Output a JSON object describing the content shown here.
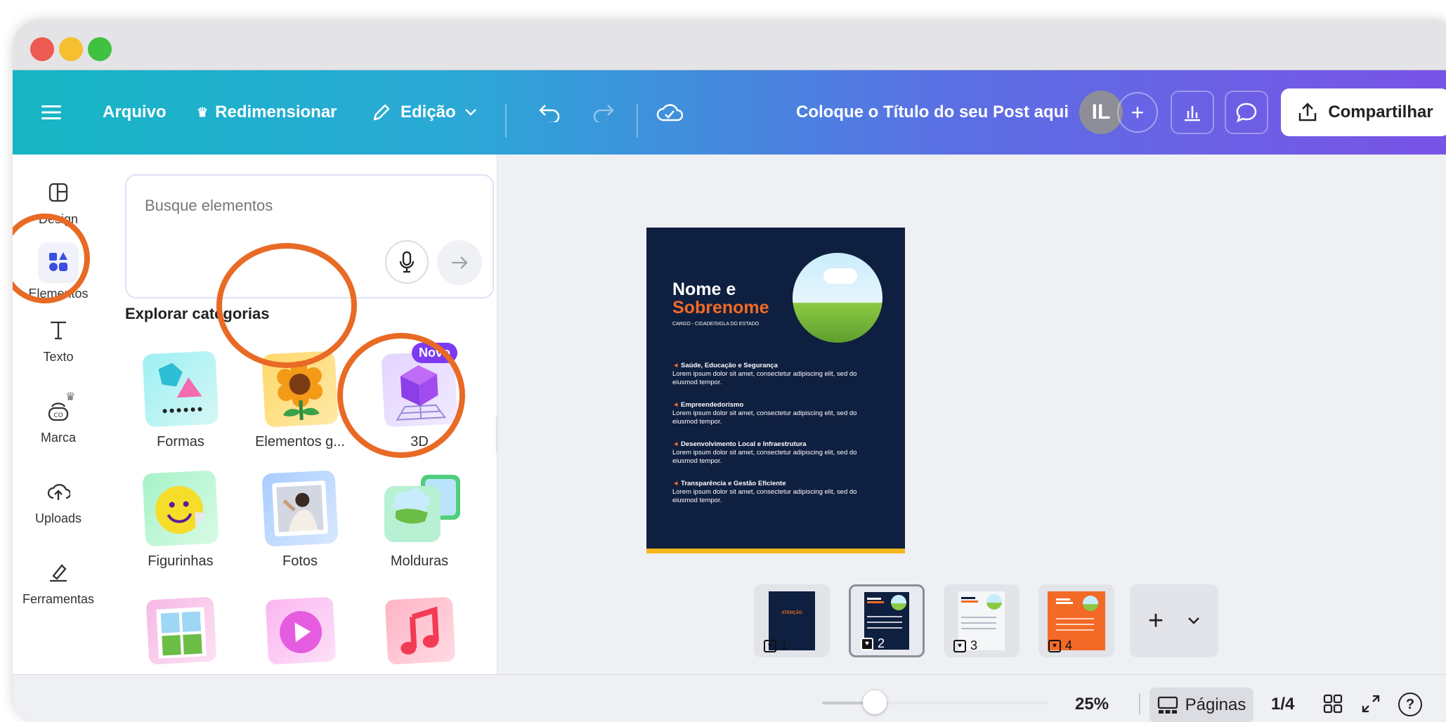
{
  "toolbar": {
    "menu_label": "Arquivo",
    "resize_label": "Redimensionar",
    "edit_label": "Edição",
    "title": "Coloque o Título do seu Post aqui",
    "avatar_initials": "IL",
    "share_label": "Compartilhar"
  },
  "rail": {
    "items": [
      {
        "label": "Design",
        "icon": "layout-icon"
      },
      {
        "label": "Elementos",
        "icon": "shapes-icon"
      },
      {
        "label": "Texto",
        "icon": "text-icon"
      },
      {
        "label": "Marca",
        "icon": "brand-icon"
      },
      {
        "label": "Uploads",
        "icon": "cloud-upload-icon"
      },
      {
        "label": "Ferramentas",
        "icon": "pen-tool-icon"
      }
    ]
  },
  "panel": {
    "search_placeholder": "Busque elementos",
    "section_title": "Explorar categorias",
    "badge_new": "Novo",
    "categories": [
      {
        "label": "Formas"
      },
      {
        "label": "Elementos g..."
      },
      {
        "label": "3D"
      },
      {
        "label": "Figurinhas"
      },
      {
        "label": "Fotos"
      },
      {
        "label": "Molduras"
      }
    ]
  },
  "page": {
    "name_line1": "Nome e",
    "name_line2": "Sobrenome",
    "subtitle": "CARGO - CIDADE/SIGLA DO ESTADO",
    "items": [
      {
        "title": "Saúde, Educação e Segurança",
        "text": "Lorem ipsum dolor sit amet, consectetur adipiscing elit, sed do eiusmod tempor."
      },
      {
        "title": "Empreendedorismo",
        "text": "Lorem ipsum dolor sit amet, consectetur adipiscing elit, sed do eiusmod tempor."
      },
      {
        "title": "Desenvolvimento Local e Infraestrutura",
        "text": "Lorem ipsum dolor sit amet, consectetur adipiscing elit, sed do eiusmod tempor."
      },
      {
        "title": "Transparência e Gestão Eficiente",
        "text": "Lorem ipsum dolor sit amet, consectetur adipiscing elit, sed do eiusmod tempor."
      }
    ]
  },
  "thumbs": [
    {
      "num": "1",
      "caption": "ATENÇÃO"
    },
    {
      "num": "2"
    },
    {
      "num": "3"
    },
    {
      "num": "4"
    }
  ],
  "bottom": {
    "zoom": "25%",
    "zoom_fraction": 0.25,
    "pages_label": "Páginas",
    "page_count": "1/4"
  },
  "colors": {
    "accent_orange": "#e86a25",
    "page_navy": "#0f1f3f",
    "brand_purple": "#7a52e6",
    "brand_teal": "#16b6c4"
  }
}
